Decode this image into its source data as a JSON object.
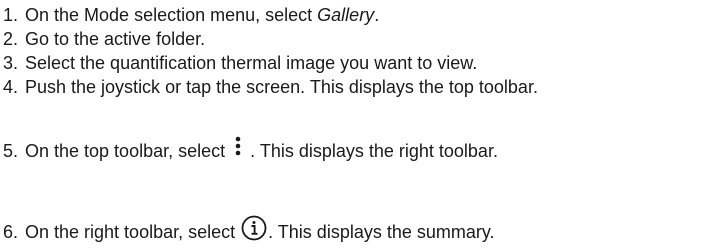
{
  "steps": [
    {
      "number": "1.",
      "before": "On the Mode selection menu, select ",
      "emphasis": "Gallery",
      "after": "."
    },
    {
      "number": "2.",
      "text": "Go to the active folder."
    },
    {
      "number": "3.",
      "text": "Select the quantification thermal image you want to view."
    },
    {
      "number": "4.",
      "text": "Push the joystick or tap the screen. This displays the top toolbar."
    },
    {
      "number": "5.",
      "before": "On the top toolbar, select ",
      "icon": "more-vertical-icon",
      "after": ". This displays the right toolbar."
    },
    {
      "number": "6.",
      "before": "On the right toolbar, select ",
      "icon": "info-icon",
      "after": ". This displays the summary."
    }
  ]
}
